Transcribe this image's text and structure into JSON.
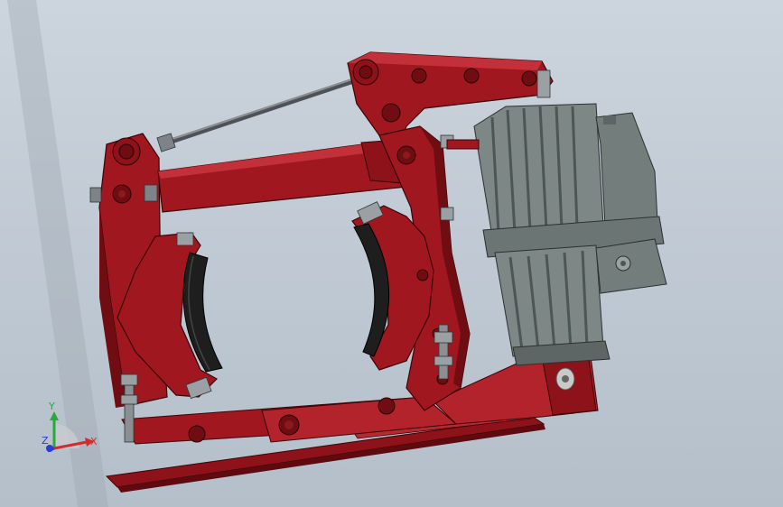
{
  "viewport": {
    "background_top": "#ccd4dd",
    "background_bottom": "#b4bfca"
  },
  "model": {
    "frame_color": "#a11720",
    "frame_dark": "#6f0d12",
    "frame_edge": "#3a0508",
    "motor_color": "#7d8785",
    "motor_dark": "#4e5654",
    "rod_color": "#5a5e62",
    "bolt_color": "#8a8f94"
  },
  "triad": {
    "x_label": "X",
    "y_label": "Y",
    "z_label": "Z",
    "x_color": "#d42a2a",
    "y_color": "#2aa83a",
    "z_color": "#2a3ad4"
  }
}
